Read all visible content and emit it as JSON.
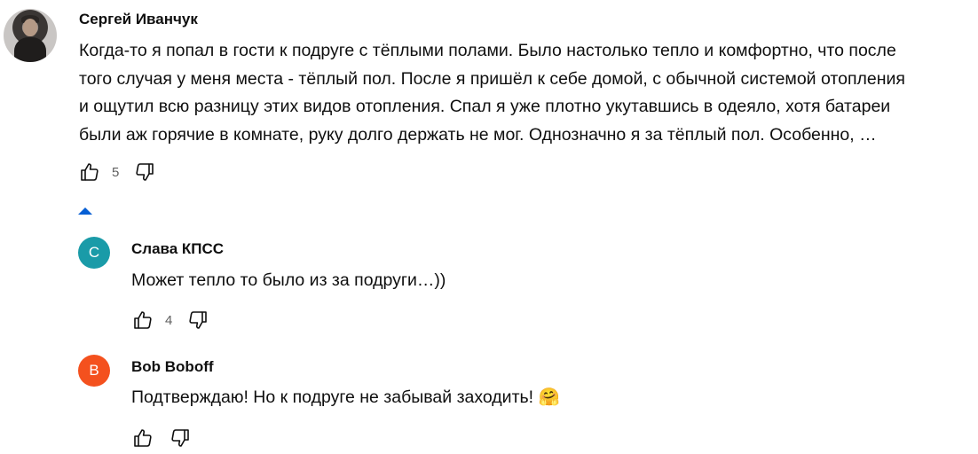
{
  "comments": [
    {
      "author": "Сергей Иванчук",
      "avatar_icon": "user-photo",
      "lines": [
        "Когда-то я попал в гости к подруге с тёплыми полами. Было настолько тепло и комфортно, что после",
        "того случая у меня места - тёплый пол. После я пришёл к себе домой, с обычной системой отопления",
        "и ощутил всю разницу этих видов отопления. Спал я уже плотно укутавшись в одеяло, хотя батареи",
        "были аж горячие в комнате, руку долго держать не мог. Однозначно я за тёплый пол. Особенно, …"
      ],
      "likes": "5"
    }
  ],
  "replies": [
    {
      "author": "Слава КПСС",
      "avatar_letter": "С",
      "avatar_color": "#1a9ba8",
      "text": "Может тепло то было из за подруги…))",
      "likes": "4"
    },
    {
      "author": "Bob Boboff",
      "avatar_letter": "B",
      "avatar_color": "#f4511e",
      "text": "Подтверждаю! Но к подруге не забывай заходить! 🤗",
      "likes": ""
    }
  ],
  "accent_color": "#065fd4"
}
